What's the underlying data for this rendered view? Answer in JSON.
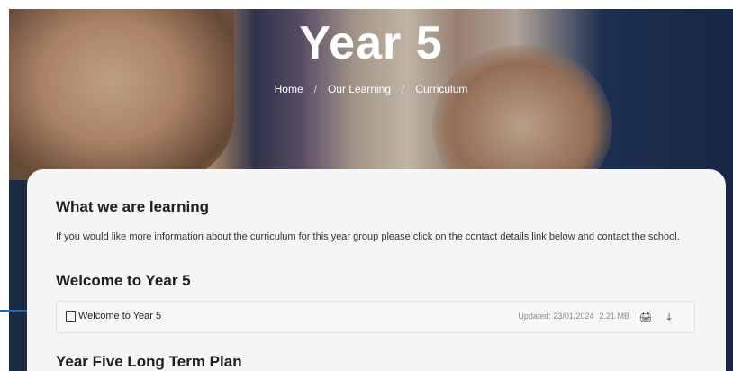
{
  "hero": {
    "title": "Year 5",
    "breadcrumb": [
      "Home",
      "Our Learning",
      "Curriculum"
    ]
  },
  "content": {
    "section_heading": "What we are learning",
    "intro": "If you would like more information about the curriculum for this year group please click on the contact details link below and contact the school.",
    "welcome_heading": "Welcome to Year 5",
    "file": {
      "name": "Welcome to Year 5",
      "icon": "document-icon",
      "updated": "Updated: 23/01/2024",
      "size": "2.21 MB",
      "print_icon": "printer-icon",
      "download_icon": "download-icon"
    },
    "plan_heading": "Year Five Long Term Plan"
  },
  "colors": {
    "accent": "#1c6bb3",
    "card_bg": "#f5f5f5",
    "heading": "#1e1e1e"
  }
}
